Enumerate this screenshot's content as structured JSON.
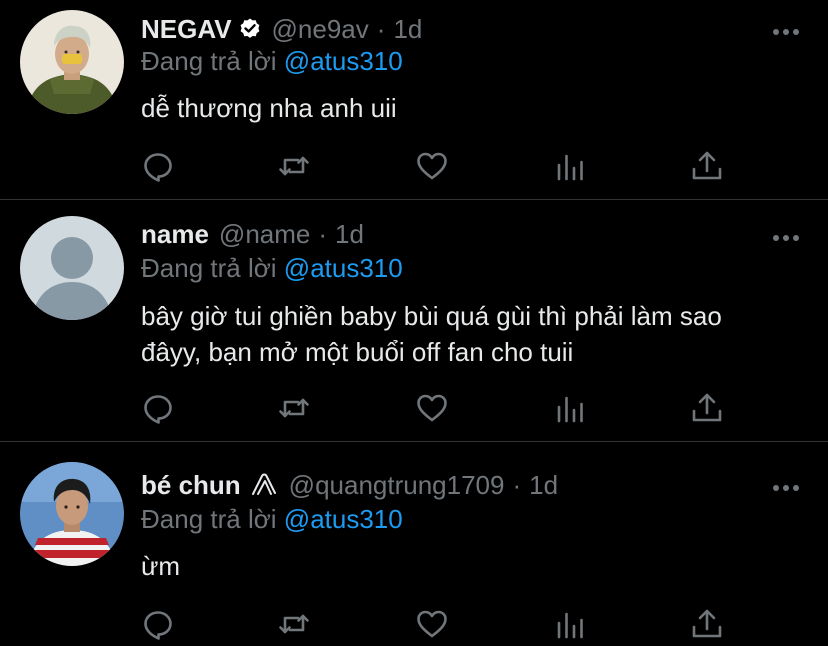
{
  "tweets": [
    {
      "name": "NEGAV",
      "handle": "@ne9av",
      "separator": "·",
      "time": "1d",
      "replying_prefix": "Đang trả lời",
      "replying_to": "@atus310",
      "text": "dễ thương nha anh uii",
      "verified": true,
      "avatar": "photo-person-green-jacket"
    },
    {
      "name": "name",
      "handle": "@name",
      "separator": "·",
      "time": "1d",
      "replying_prefix": "Đang trả lời",
      "replying_to": "@atus310",
      "text": "bây giờ tui ghiền baby bùi quá gùi thì phải làm sao\nđâyy, bạn mở một buổi off fan cho tuii",
      "verified": false,
      "avatar": "default-person-placeholder"
    },
    {
      "name": "bé chun",
      "handle": "@quangtrung1709",
      "separator": "·",
      "time": "1d",
      "replying_prefix": "Đang trả lời",
      "replying_to": "@atus310",
      "text": "ừm",
      "verified": false,
      "avatar": "photo-person-striped-sweater"
    }
  ],
  "icons": {
    "reply": "reply-icon",
    "retweet": "retweet-icon",
    "like": "heart-icon",
    "views": "views-icon",
    "share": "share-icon",
    "more": "more-icon"
  },
  "colors": {
    "background": "#000000",
    "text": "#e7e9ea",
    "muted": "#71767b",
    "accent": "#1d9bf0",
    "divider": "#2f3336"
  }
}
